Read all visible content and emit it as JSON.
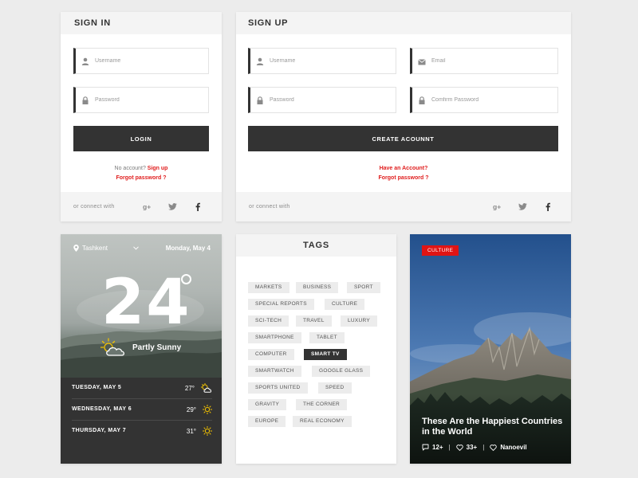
{
  "signin": {
    "title": "SIGN IN",
    "username_placeholder": "Username",
    "password_placeholder": "Password",
    "login_label": "LOGIN",
    "no_account_text": "No account?",
    "signup_link": "Sign up",
    "forgot_link": "Forgot password ?",
    "connect_text": "or connect with",
    "social_icons": [
      "google-plus-icon",
      "twitter-icon",
      "facebook-icon"
    ]
  },
  "signup": {
    "title": "SIGN UP",
    "username_placeholder": "Username",
    "email_placeholder": "Email",
    "password_placeholder": "Password",
    "confirm_placeholder": "Comfirm Password",
    "create_label": "CREATE ACOUNNT",
    "have_account_link": "Have an Account?",
    "forgot_link": "Forgot password ?",
    "connect_text": "or connect with",
    "social_icons": [
      "google-plus-icon",
      "twitter-icon",
      "facebook-icon"
    ]
  },
  "weather": {
    "location": "Tashkent",
    "date": "Monday, May 4",
    "temperature": "24",
    "condition": "Partly Sunny",
    "forecast": [
      {
        "day": "TUESDAY, MAY 5",
        "temp": "27°",
        "icon": "partly-cloudy-icon"
      },
      {
        "day": "WEDNESDAY, MAY 6",
        "temp": "29°",
        "icon": "sun-icon"
      },
      {
        "day": "THURSDAY, MAY 7",
        "temp": "31°",
        "icon": "sun-icon"
      }
    ]
  },
  "tags": {
    "title": "TAGS",
    "items": [
      {
        "label": "MARKETS",
        "active": false
      },
      {
        "label": "BUSINESS",
        "active": false
      },
      {
        "label": "SPORT",
        "active": false
      },
      {
        "label": "SPECIAL REPORTS",
        "active": false
      },
      {
        "label": "CULTURE",
        "active": false
      },
      {
        "label": "SCI-TECH",
        "active": false
      },
      {
        "label": "TRAVEL",
        "active": false
      },
      {
        "label": "LUXURY",
        "active": false
      },
      {
        "label": "SMARTPHONE",
        "active": false
      },
      {
        "label": "TABLET",
        "active": false
      },
      {
        "label": "COMPUTER",
        "active": false
      },
      {
        "label": "SMART TV",
        "active": true
      },
      {
        "label": "SMARTWATCH",
        "active": false
      },
      {
        "label": "GOOGLE GLASS",
        "active": false
      },
      {
        "label": "SPORTS UNITED",
        "active": false
      },
      {
        "label": "SPEED",
        "active": false
      },
      {
        "label": "GRAVITY",
        "active": false
      },
      {
        "label": "THE CORNER",
        "active": false
      },
      {
        "label": "EUROPE",
        "active": false
      },
      {
        "label": "REAL ECONOMY",
        "active": false
      }
    ]
  },
  "article": {
    "badge": "CULTURE",
    "title": "These Are the Happiest Countries in the World",
    "comments": "12+",
    "likes": "33+",
    "author": "Nanoevil"
  },
  "colors": {
    "accent_red": "#e01d1d",
    "dark": "#333333",
    "sun_yellow": "#f2c200"
  }
}
